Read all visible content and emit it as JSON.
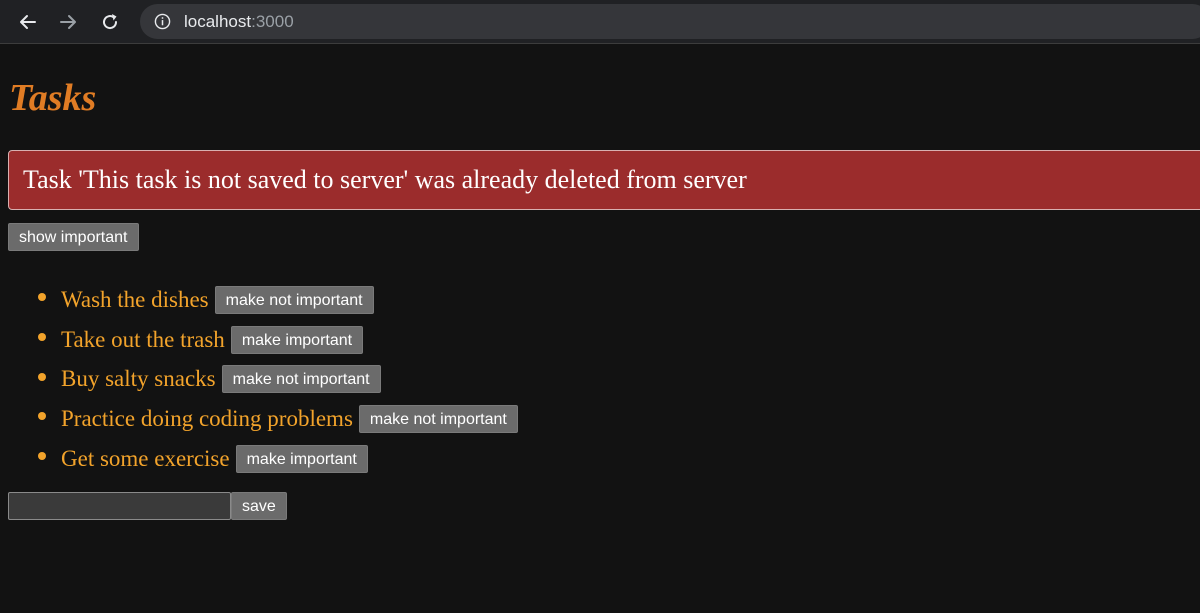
{
  "browser": {
    "url_host": "localhost",
    "url_port": ":3000",
    "icons": {
      "back": "arrow-left-icon",
      "forward": "arrow-right-icon",
      "reload": "reload-icon",
      "info": "info-icon"
    }
  },
  "app": {
    "title": "Tasks",
    "notification": "Task 'This task is not saved to server' was already deleted from server",
    "toggle_label": "show important",
    "tasks": [
      {
        "text": "Wash the dishes",
        "button": "make not important"
      },
      {
        "text": "Take out the trash",
        "button": "make important"
      },
      {
        "text": "Buy salty snacks",
        "button": "make not important"
      },
      {
        "text": "Practice doing coding problems",
        "button": "make not important"
      },
      {
        "text": "Get some exercise",
        "button": "make important"
      }
    ],
    "new_task_value": "",
    "save_label": "save"
  },
  "colors": {
    "background": "#121212",
    "title": "#e07c24",
    "task_text": "#f2a32b",
    "error_background": "#9b2c2c",
    "button_background": "#6b6b6b"
  }
}
